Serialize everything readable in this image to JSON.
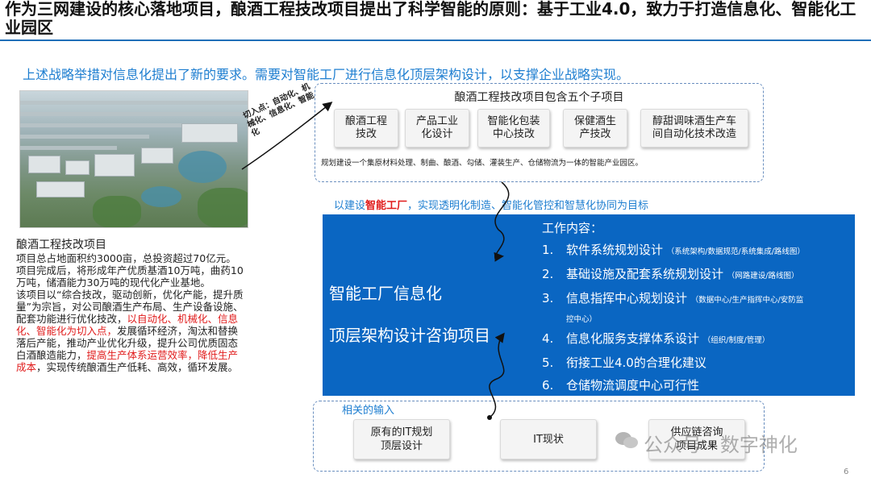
{
  "title": "作为三网建设的核心落地项目，酿酒工程技改项目提出了科学智能的原则：基于工业4.0，致力于打造信息化、智能化工业园区",
  "subtitle": "上述战略举措对信息化提出了新的要求。需要对智能工厂进行信息化顶层架构设计，以支撑企业战略实现。",
  "photo_label": "切入点：自动化、机械化、信息化、智能化",
  "left_panel": {
    "heading": "酿酒工程技改项目",
    "p1": "项目总占地面积约3000亩，总投资超过70亿元。",
    "p2": "项目完成后，将形成年产优质基酒10万吨，曲药10万吨，储酒能力30万吨的现代化产业基地。",
    "p3a": "该项目以“综合技改，驱动创新，优化产能，提升质量”为宗旨，对公司酿酒生产布局、生产设备设施、配套功能进行优化技改，",
    "p3b": "以自动化、机械化、信息化、智能化为切入点，",
    "p3c": "发展循环经济，淘汰和替换落后产能，推动产业优化升级，提升公司优质固态白酒酿造能力，",
    "p3d": "提高生产体系运营效率，降低生产成本",
    "p3e": "，实现传统酿酒生产低耗、高效，循环发展。"
  },
  "subprojects": {
    "title": "酿酒工程技改项目包含五个子项目",
    "items": [
      [
        "酿酒工程",
        "技改"
      ],
      [
        "产品工业",
        "化设计"
      ],
      [
        "智能化包装",
        "中心技改"
      ],
      [
        "保健酒生",
        "产技改"
      ],
      [
        "醇甜调味酒生产车",
        "间自动化技术改造"
      ]
    ],
    "note": "规划建设一个集原材料处理、制曲、酿酒、勾储、灌装生产、仓储物流为一体的智能产业园区。"
  },
  "goal": {
    "prefix": "以建设",
    "highlight": "智能工厂",
    "suffix": "，实现透明化制造、智能化管控和智慧化协同为目标"
  },
  "consulting": {
    "line1": "智能工厂信息化",
    "line2": "顶层架构设计咨询项目",
    "work_title": "工作内容：",
    "items": [
      {
        "num": "1.",
        "text": "软件系统规划设计",
        "detail": "（系统架构/数据规范/系统集成/路线图）"
      },
      {
        "num": "2.",
        "text": "基础设施及配套系统规划设计",
        "detail": "（网路建设/路线图）"
      },
      {
        "num": "3.",
        "text": "信息指挥中心规划设计",
        "detail": "（数据中心/生产指挥中心/安防监",
        "detail2": "控中心）"
      },
      {
        "num": "4.",
        "text": "信息化服务支撑体系设计",
        "detail": "（组织/制度/管理）"
      },
      {
        "num": "5.",
        "text": "衔接工业4.0的合理化建议",
        "detail": ""
      },
      {
        "num": "6.",
        "text": "仓储物流调度中心可行性",
        "detail": ""
      }
    ]
  },
  "inputs": {
    "title": "相关的输入",
    "items": [
      [
        "原有的IT规划",
        "顶层设计"
      ],
      [
        "IT现状"
      ],
      [
        "供应链咨询",
        "项目成果"
      ]
    ]
  },
  "watermark": "公众号 · 数字神化",
  "page_number": "6"
}
